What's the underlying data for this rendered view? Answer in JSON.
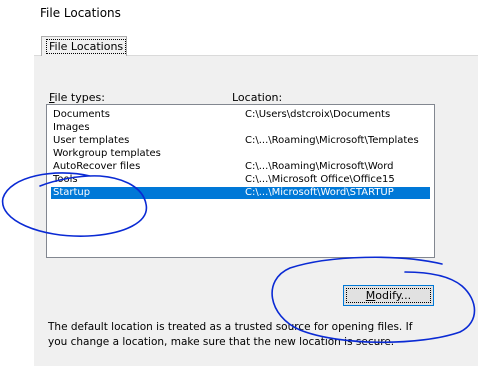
{
  "window": {
    "title": "File Locations"
  },
  "tab": {
    "label": "File Locations"
  },
  "list": {
    "col_type_prefix": "",
    "col_type_mnemonic": "F",
    "col_type_rest": "ile types:",
    "col_location": "Location:",
    "rows": [
      {
        "type": "Documents",
        "location": "C:\\Users\\dstcroix\\Documents"
      },
      {
        "type": "Images",
        "location": ""
      },
      {
        "type": "User templates",
        "location": "C:\\...\\Roaming\\Microsoft\\Templates"
      },
      {
        "type": "Workgroup templates",
        "location": ""
      },
      {
        "type": "AutoRecover files",
        "location": "C:\\...\\Roaming\\Microsoft\\Word"
      },
      {
        "type": "Tools",
        "location": "C:\\...\\Microsoft Office\\Office15"
      },
      {
        "type": "Startup",
        "location": "C:\\...\\Microsoft\\Word\\STARTUP"
      }
    ],
    "selected_index": 6
  },
  "buttons": {
    "modify_mnemonic": "M",
    "modify_rest": "odify..."
  },
  "info": {
    "text": "The default location is treated as a trusted source for opening files. If you change a location, make sure that the new location is secure."
  },
  "colors": {
    "selection": "#0078d7",
    "annotation_ink": "#0a2ad4",
    "panel": "#f0f0f0"
  }
}
